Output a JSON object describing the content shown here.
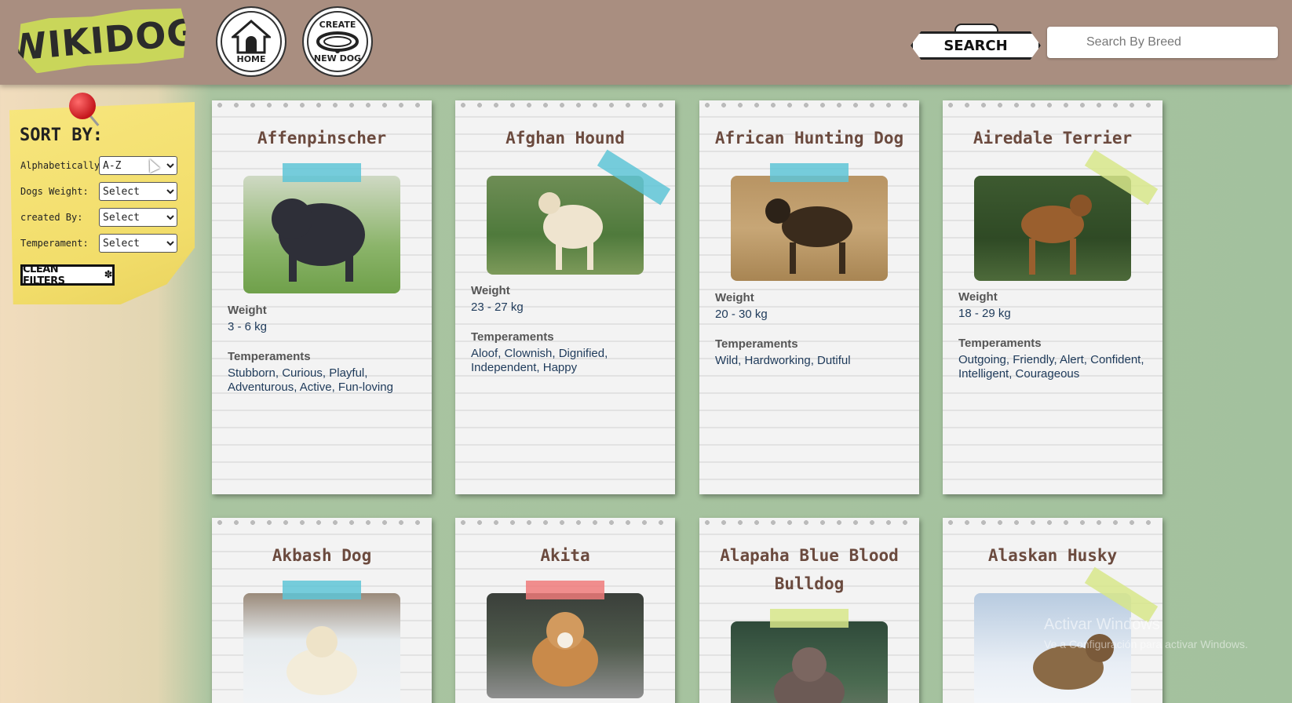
{
  "header": {
    "logo_text": "WIKIDOG",
    "home_label": "HOME",
    "create_top": "CREATE",
    "create_bottom": "NEW DOG",
    "search_button_label": "SEARCH",
    "search_placeholder": "Search By Breed"
  },
  "filters": {
    "title": "SORT BY:",
    "alphabetically_label": "Alphabetically:",
    "alphabetically_value": "A-Z",
    "weight_label": "Dogs Weight:",
    "weight_value": "Select",
    "created_label": "created By:",
    "created_value": "Select",
    "temperament_label": "Temperament:",
    "temperament_value": "Select",
    "clean_label": "CLEAN FILTERS"
  },
  "cards": [
    {
      "name": "Affenpinscher",
      "weight_label": "Weight",
      "weight": "3 - 6 kg",
      "temperaments_label": "Temperaments",
      "temperaments": "Stubborn, Curious, Playful, Adventurous, Active, Fun-loving",
      "tape_color": "#5ec4d6"
    },
    {
      "name": "Afghan Hound",
      "weight_label": "Weight",
      "weight": "23 - 27 kg",
      "temperaments_label": "Temperaments",
      "temperaments": "Aloof, Clownish, Dignified, Independent, Happy",
      "tape_color": "#5ec4d6"
    },
    {
      "name": "African Hunting Dog",
      "weight_label": "Weight",
      "weight": "20 - 30 kg",
      "temperaments_label": "Temperaments",
      "temperaments": "Wild, Hardworking, Dutiful",
      "tape_color": "#5ec4d6"
    },
    {
      "name": "Airedale Terrier",
      "weight_label": "Weight",
      "weight": "18 - 29 kg",
      "temperaments_label": "Temperaments",
      "temperaments": "Outgoing, Friendly, Alert, Confident, Intelligent, Courageous",
      "tape_color": "#d7e68a"
    },
    {
      "name": "Akbash Dog",
      "tape_color": "#5ec4d6"
    },
    {
      "name": "Akita",
      "tape_color": "#ee7a7a"
    },
    {
      "name": "Alapaha Blue Blood Bulldog",
      "tape_color": "#d7e68a"
    },
    {
      "name": "Alaskan Husky",
      "tape_color": "#d7e68a"
    }
  ],
  "watermark": {
    "line1": "Activar Windows",
    "line2": "Ve a Configuración para activar Windows."
  }
}
